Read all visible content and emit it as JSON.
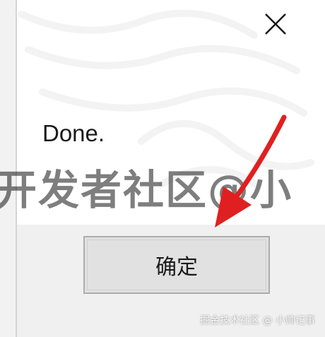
{
  "dialog": {
    "message": "Done.",
    "ok_label": "确定"
  },
  "icons": {
    "close": "close-icon",
    "arrow": "red-arrow-annotation"
  },
  "overlays": {
    "watermark": "开发者社区@小",
    "corner_watermark": "掘金技术社区 @ 小帅记事"
  },
  "colors": {
    "arrow": "#e02020",
    "button_bg": "#e1e1e1",
    "button_border": "#adadad"
  }
}
